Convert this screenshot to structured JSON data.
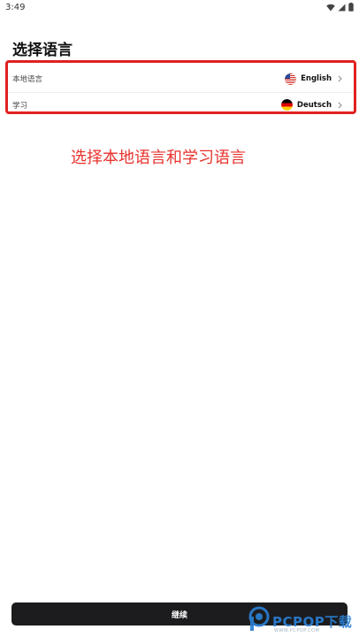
{
  "status_bar": {
    "time": "3:49",
    "icons": [
      "wifi-icon",
      "signal-icon",
      "battery-icon"
    ]
  },
  "page": {
    "title": "选择语言"
  },
  "languages": {
    "native": {
      "label": "本地语言",
      "value": "English",
      "flag": "us-flag-icon"
    },
    "learning": {
      "label": "学习",
      "value": "Deutsch",
      "flag": "de-flag-icon"
    }
  },
  "annotation": {
    "text": "选择本地语言和学习语言"
  },
  "actions": {
    "continue_label": "继续"
  },
  "watermark": {
    "brand": "PCPOP下载",
    "sub": "WWW.PCPOP.COM"
  },
  "colors": {
    "highlight_border": "#e02020",
    "annotation": "#e8322c",
    "button_bg": "#1c1c1e",
    "watermark": "#2a7fd4"
  }
}
